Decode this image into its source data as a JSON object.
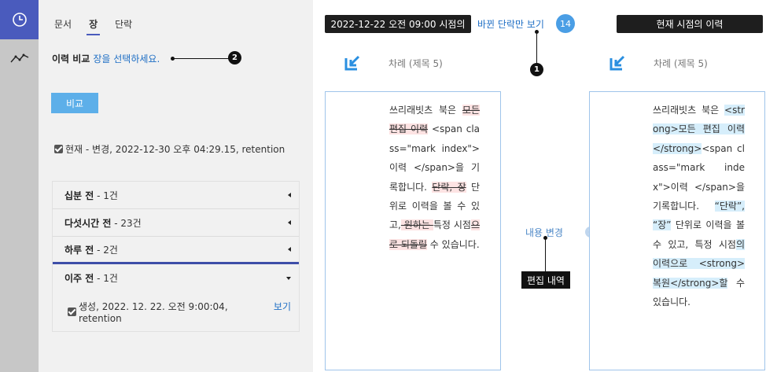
{
  "sidebar_icons": [
    "clock-icon",
    "line-chart-icon"
  ],
  "tabs": [
    {
      "label": "문서",
      "active": false
    },
    {
      "label": "장",
      "active": true
    },
    {
      "label": "단락",
      "active": false
    }
  ],
  "compare": {
    "label": "이력 비교",
    "hint": "장을 선택하세요.",
    "callout_number": "2",
    "button_label": "비교"
  },
  "current_revision": "현재 - 변경, 2022-12-30 오후 04:29.15, retention",
  "history_groups": [
    {
      "title": "십분 전",
      "count": " - 1건",
      "expanded": false
    },
    {
      "title": "다섯시간 전",
      "count": " - 23건",
      "expanded": false
    },
    {
      "title": "하루 전",
      "count": " - 2건",
      "expanded": false,
      "selected": true
    },
    {
      "title": "이주 전",
      "count": " - 1건",
      "expanded": true
    }
  ],
  "history_entry": {
    "text": "생성, 2022. 12. 22. 오전 9:00:04, retention",
    "view_label": "보기"
  },
  "left_header": "2022-12-22 오전 09:00 시점의",
  "diff_only_link": "바뀐 단락만 보기",
  "diff_count": "14",
  "diff_callout_number": "1",
  "right_header": "현재 시점의 이력",
  "toc_label": "차례 (제목 5)",
  "content_change_label": "내용 변경",
  "edit_history_tag": "편집 내역",
  "left_doc": {
    "p1": "쓰리래빗츠 북은 ",
    "del1": "모든 편집 이력",
    "p2": " <span class=\"mark index\">이력 </span>을 기록합니다. ",
    "del2": "단락, 장",
    "p3": " 단위로 이력을 볼 수 있고,",
    "del3": " 원하는 ",
    "p4": "특정 시점",
    "del4": "으로 되돌릴",
    "p5": " 수 있습니다."
  },
  "right_doc": {
    "p1": "쓰리래빗츠 북은 ",
    "ins1": "<strong>모든 편집 이력</strong>",
    "p2": "<span class=\"mark index\">이력 </span>을 기록합니다. ",
    "ins2": "“단락”, “장”",
    "p3": " 단위로 이력을 볼 수 있고, 특정 시점",
    "ins3": "의 이력으로 <strong>복원</strong>할",
    "p4": " 수 있습니다."
  },
  "colors": {
    "accent": "#4a5bbd",
    "link": "#1f6fc5",
    "compare_button": "#5dafe9",
    "deleted_bg": "#fde3e3",
    "inserted_bg": "#d6eefb",
    "doc_border": "#9fc4ea"
  }
}
